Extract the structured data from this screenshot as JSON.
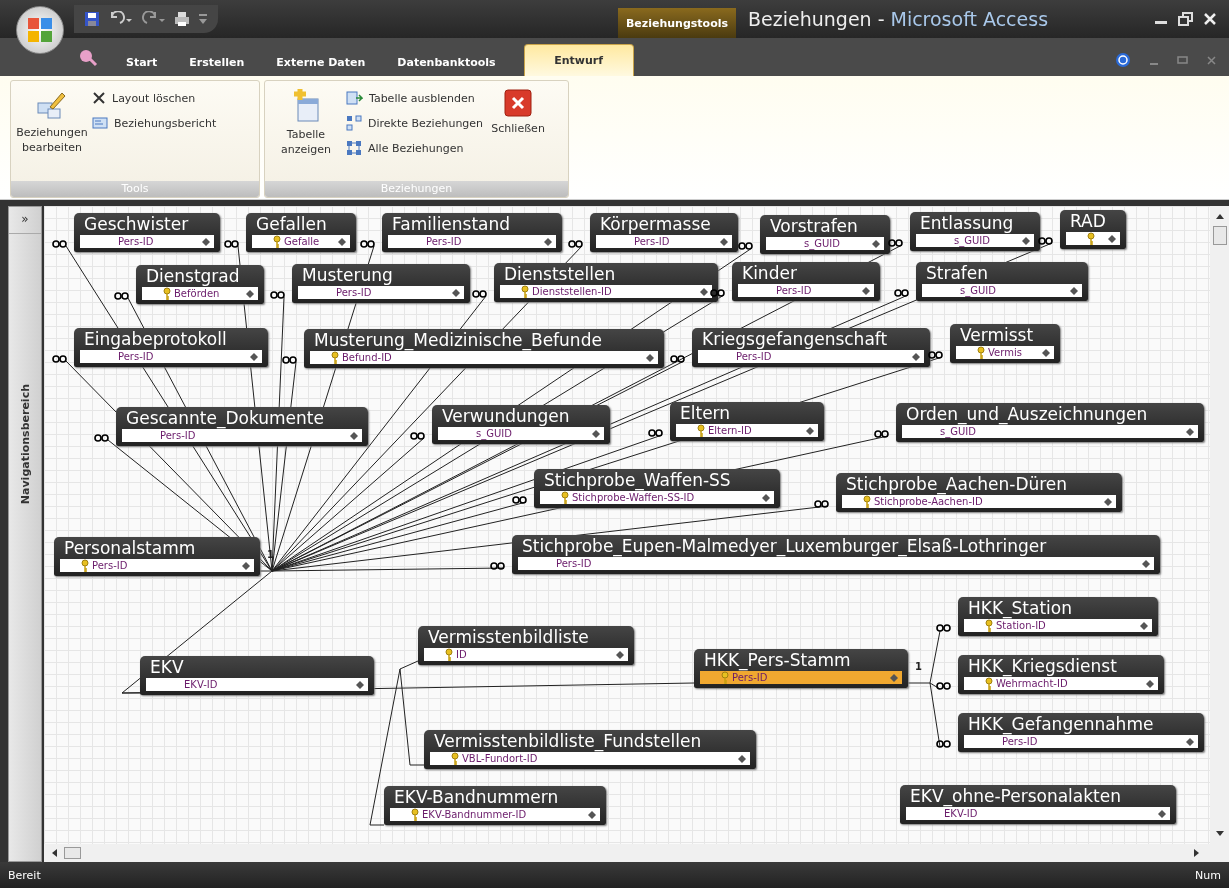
{
  "window": {
    "title": "Beziehungen",
    "separator": "-",
    "app": "Microsoft Access",
    "context_tab": "Beziehungstools"
  },
  "tabs": [
    {
      "label": "Start",
      "selected": false
    },
    {
      "label": "Erstellen",
      "selected": false
    },
    {
      "label": "Externe Daten",
      "selected": false
    },
    {
      "label": "Datenbanktools",
      "selected": false
    },
    {
      "label": "Entwurf",
      "selected": true
    }
  ],
  "ribbon_groups": [
    {
      "label": "Tools",
      "buttons": [
        {
          "kind": "large",
          "label": "Beziehungen bearbeiten"
        },
        {
          "kind": "small",
          "label": "Layout löschen"
        },
        {
          "kind": "small",
          "label": "Beziehungsbericht"
        }
      ]
    },
    {
      "label": "Beziehungen",
      "buttons": [
        {
          "kind": "large",
          "label": "Tabelle anzeigen"
        },
        {
          "kind": "small",
          "label": "Tabelle ausblenden"
        },
        {
          "kind": "small",
          "label": "Direkte Beziehungen"
        },
        {
          "kind": "small",
          "label": "Alle Beziehungen"
        },
        {
          "kind": "large",
          "label": "Schließen"
        }
      ]
    }
  ],
  "nav_pane": {
    "toggle": "»",
    "label": "Navigationsbereich"
  },
  "tables": [
    {
      "name": "Geschwister",
      "field": "Pers-ID",
      "key": false,
      "many_end": true,
      "selected": false
    },
    {
      "name": "Gefallen",
      "field": "Gefalle",
      "key": true,
      "many_end": true,
      "selected": false
    },
    {
      "name": "Familienstand",
      "field": "Pers-ID",
      "key": false,
      "many_end": true,
      "selected": false
    },
    {
      "name": "Körpermasse",
      "field": "Pers-ID",
      "key": false,
      "many_end": true,
      "selected": false
    },
    {
      "name": "Vorstrafen",
      "field": "s_GUID",
      "key": false,
      "many_end": true,
      "selected": false
    },
    {
      "name": "Entlassung",
      "field": "s_GUID",
      "key": false,
      "many_end": true,
      "selected": false
    },
    {
      "name": "RAD",
      "key": true,
      "many_end": true,
      "selected": false
    },
    {
      "name": "Dienstgrad",
      "field": "Beförden",
      "key": true,
      "many_end": true,
      "selected": false
    },
    {
      "name": "Musterung",
      "field": "Pers-ID",
      "key": false,
      "many_end": true,
      "selected": false
    },
    {
      "name": "Dienststellen",
      "field": "Dienststellen-ID",
      "key": true,
      "many_end": true,
      "selected": false
    },
    {
      "name": "Kinder",
      "field": "Pers-ID",
      "key": false,
      "many_end": true,
      "selected": false
    },
    {
      "name": "Strafen",
      "field": "s_GUID",
      "key": false,
      "many_end": true,
      "selected": false
    },
    {
      "name": "Eingabeprotokoll",
      "field": "Pers-ID",
      "key": false,
      "many_end": true,
      "selected": false
    },
    {
      "name": "Musterung_Medizinische_Befunde",
      "field": "Befund-ID",
      "key": true,
      "many_end": true,
      "selected": false
    },
    {
      "name": "Kriegsgefangenschaft",
      "field": "Pers-ID",
      "key": false,
      "many_end": true,
      "selected": false
    },
    {
      "name": "Vermisst",
      "field": "Vermis",
      "key": true,
      "many_end": true,
      "selected": false
    },
    {
      "name": "Gescannte_Dokumente",
      "field": "Pers-ID",
      "key": false,
      "many_end": true,
      "selected": false
    },
    {
      "name": "Verwundungen",
      "field": "s_GUID",
      "key": false,
      "many_end": true,
      "selected": false
    },
    {
      "name": "Eltern",
      "field": "Eltern-ID",
      "key": true,
      "many_end": true,
      "selected": false
    },
    {
      "name": "Orden_und_Auszeichnungen",
      "field": "s_GUID",
      "key": false,
      "many_end": true,
      "selected": false
    },
    {
      "name": "Stichprobe_Waffen-SS",
      "field": "Stichprobe-Waffen-SS-ID",
      "key": true,
      "many_end": true,
      "selected": false
    },
    {
      "name": "Stichprobe_Aachen-Düren",
      "field": "Stichprobe-Aachen-ID",
      "key": true,
      "many_end": true,
      "selected": false
    },
    {
      "name": "Personalstamm",
      "field": "Pers-ID",
      "key": true,
      "many_end": false,
      "one_label": "1",
      "selected": false
    },
    {
      "name": "Stichprobe_Eupen-Malmedyer_Luxemburger_Elsaß-Lothringer",
      "field": "Pers-ID",
      "key": false,
      "many_end": true,
      "selected": false
    },
    {
      "name": "Vermisstenbildliste",
      "field": "ID",
      "key": true,
      "many_end": false,
      "selected": false
    },
    {
      "name": "EKV",
      "field": "EKV-ID",
      "key": false,
      "many_end": false,
      "selected": false
    },
    {
      "name": "HKK_Pers-Stamm",
      "field": "Pers-ID",
      "key": true,
      "many_end": false,
      "one_label": "1",
      "selected": true
    },
    {
      "name": "HKK_Station",
      "field": "Station-ID",
      "key": true,
      "many_end": true,
      "selected": false
    },
    {
      "name": "HKK_Kriegsdienst",
      "field": "Wehrmacht-ID",
      "key": true,
      "many_end": true,
      "selected": false
    },
    {
      "name": "HKK_Gefangennahme",
      "field": "Pers-ID",
      "key": false,
      "many_end": true,
      "selected": false
    },
    {
      "name": "Vermisstenbildliste_Fundstellen",
      "field": "VBL-Fundort-ID",
      "key": true,
      "many_end": false,
      "selected": false
    },
    {
      "name": "EKV-Bandnummern",
      "field": "EKV-Bandnummer-ID",
      "key": true,
      "many_end": false,
      "selected": false
    },
    {
      "name": "EKV_ohne-Personalakten",
      "field": "EKV-ID",
      "key": false,
      "many_end": false,
      "selected": false
    }
  ],
  "status_bar": {
    "left": "Bereit",
    "right": "Num"
  }
}
